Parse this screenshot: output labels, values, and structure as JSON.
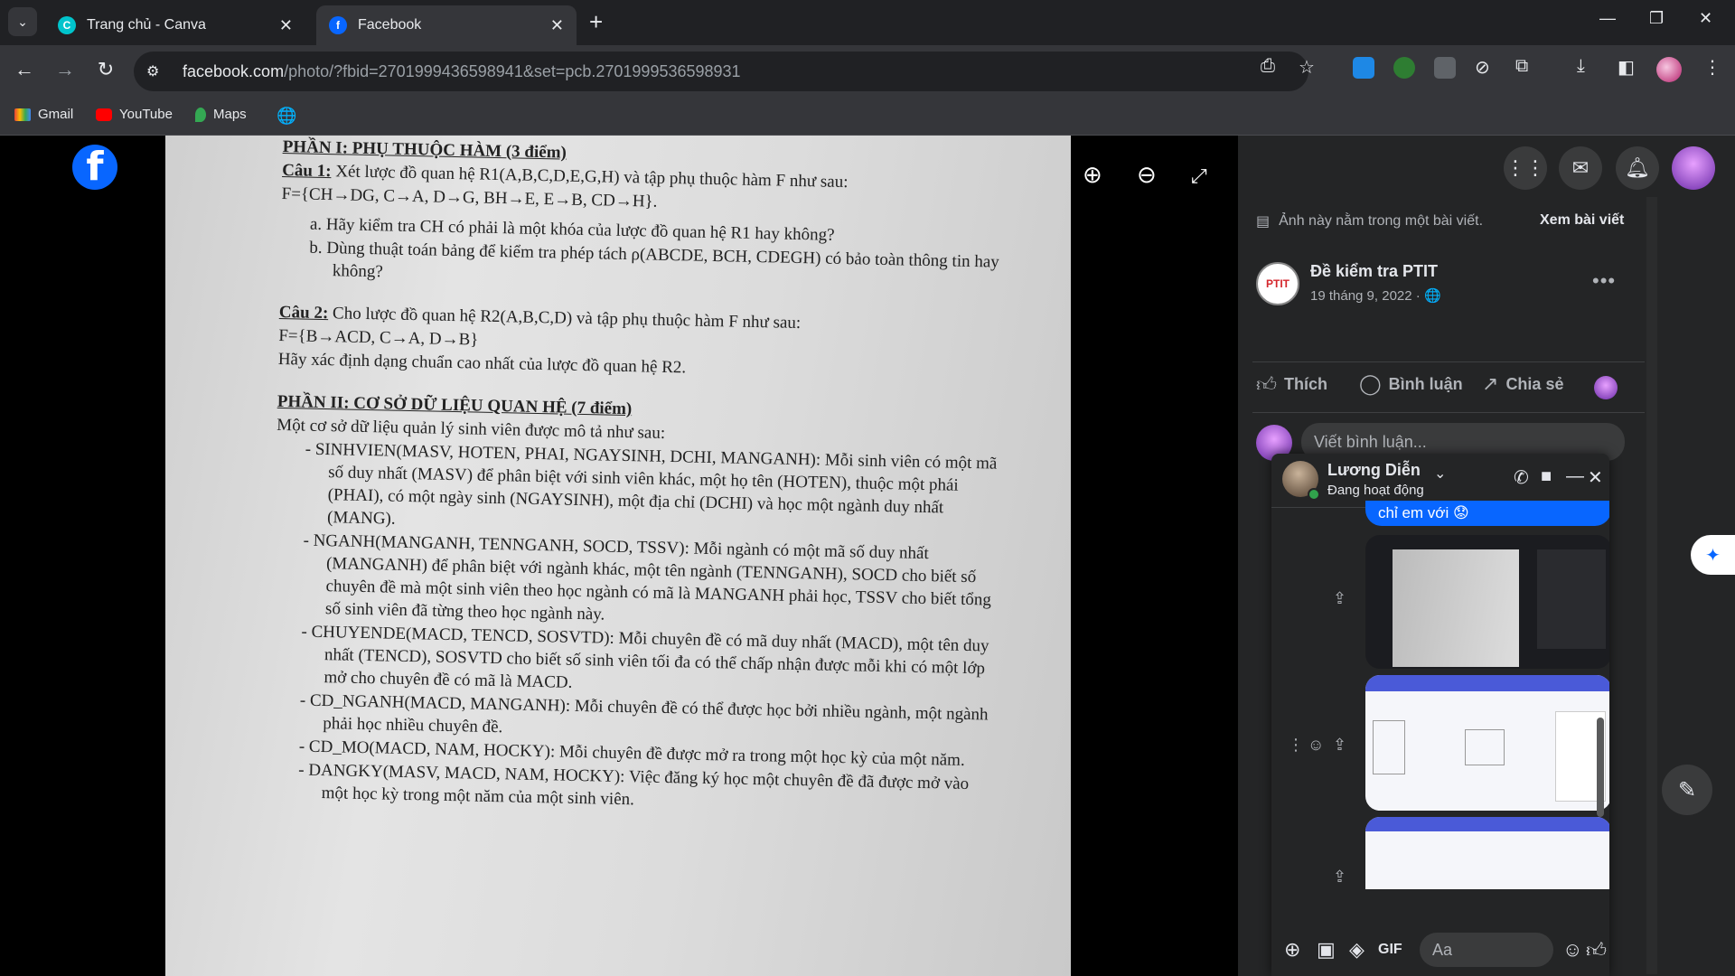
{
  "browser": {
    "tabs": [
      {
        "title": "Trang chủ - Canva",
        "active": false
      },
      {
        "title": "Facebook",
        "active": true
      }
    ],
    "url_host": "facebook.com",
    "url_path": "/photo/?fbid=2701999436598941&set=pcb.2701999536598931",
    "bookmarks": [
      {
        "label": "Gmail",
        "icon": "gmail-icon"
      },
      {
        "label": "YouTube",
        "icon": "youtube-icon"
      },
      {
        "label": "Maps",
        "icon": "maps-icon"
      }
    ]
  },
  "document": {
    "part1_title": "PHẦN I: PHỤ THUỘC HÀM (3 điểm)",
    "q1_label": "Câu 1:",
    "q1_text": " Xét lược đồ quan hệ R1(A,B,C,D,E,G,H) và tập phụ thuộc hàm F như sau:",
    "q1_f": "F={CH→DG, C→A, D→G, BH→E, E→B, CD→H}.",
    "q1_a": "a.  Hãy kiểm tra CH có phải là một khóa của lược đồ quan hệ R1 hay không?",
    "q1_b": "b.  Dùng thuật toán bảng để kiểm tra phép tách ρ(ABCDE, BCH, CDEGH) có bảo toàn thông tin hay không?",
    "q2_label": "Câu 2:",
    "q2_text": " Cho lược đồ quan hệ R2(A,B,C,D) và tập phụ thuộc hàm F như sau:",
    "q2_f": "F={B→ACD, C→A, D→B}",
    "q2_ask": "Hãy xác định dạng chuẩn cao nhất của lược đồ quan hệ R2.",
    "part2_title": "PHẦN II: CƠ SỞ DỮ LIỆU QUAN HỆ (7 điểm)",
    "part2_intro": "Một cơ sở dữ liệu quản lý sinh viên được mô tả như sau:",
    "items": [
      "-  SINHVIEN(MASV, HOTEN, PHAI, NGAYSINH, DCHI, MANGANH): Mỗi sinh viên có một mã số duy nhất (MASV) để phân biệt với sinh viên khác, một họ tên (HOTEN), thuộc một phái (PHAI), có một ngày sinh (NGAYSINH), một địa chỉ (DCHI) và học một ngành duy nhất (MANG).",
      "-  NGANH(MANGANH, TENNGANH, SOCD, TSSV): Mỗi ngành có một mã số duy nhất (MANGANH) để phân biệt với ngành khác, một tên ngành (TENNGANH), SOCD cho biết số chuyên đề mà một sinh viên theo học ngành có mã là MANGANH phải học, TSSV cho biết tổng số sinh viên đã từng theo học ngành này.",
      "-  CHUYENDE(MACD, TENCD, SOSVTD): Mỗi chuyên đề có mã duy nhất (MACD), một tên duy nhất (TENCD), SOSVTD cho biết số sinh viên tối đa có thể chấp nhận được mỗi khi có một lớp mở cho chuyên đề có mã là MACD.",
      "-  CD_NGANH(MACD, MANGANH): Mỗi chuyên đề có thể được học bởi nhiều ngành, một ngành phải học nhiều chuyên đề.",
      "-  CD_MO(MACD, NAM, HOCKY): Mỗi chuyên đề được mở ra trong một học kỳ của một năm.",
      "-  DANGKY(MASV, MACD, NAM, HOCKY): Việc đăng ký học một chuyên đề đã được mở vào một học kỳ trong một năm của một sinh viên."
    ]
  },
  "panel": {
    "notice": "Ảnh này nằm trong một bài viết.",
    "see_post": "Xem bài viết",
    "post_author": "Đề kiểm tra PTIT",
    "post_date": "19 tháng 9, 2022 · ",
    "post_avatar_text": "PTIT",
    "actions": {
      "like": "Thích",
      "comment": "Bình luận",
      "share": "Chia sẻ"
    },
    "comment_placeholder": "Viết bình luận..."
  },
  "chat": {
    "name": "Lương Diễn",
    "status": "Đang hoạt động",
    "last_message": "chỉ em với 😟",
    "input_placeholder": "Aa"
  },
  "colors": {
    "facebook_blue": "#0866ff",
    "online_green": "#31a24c"
  }
}
